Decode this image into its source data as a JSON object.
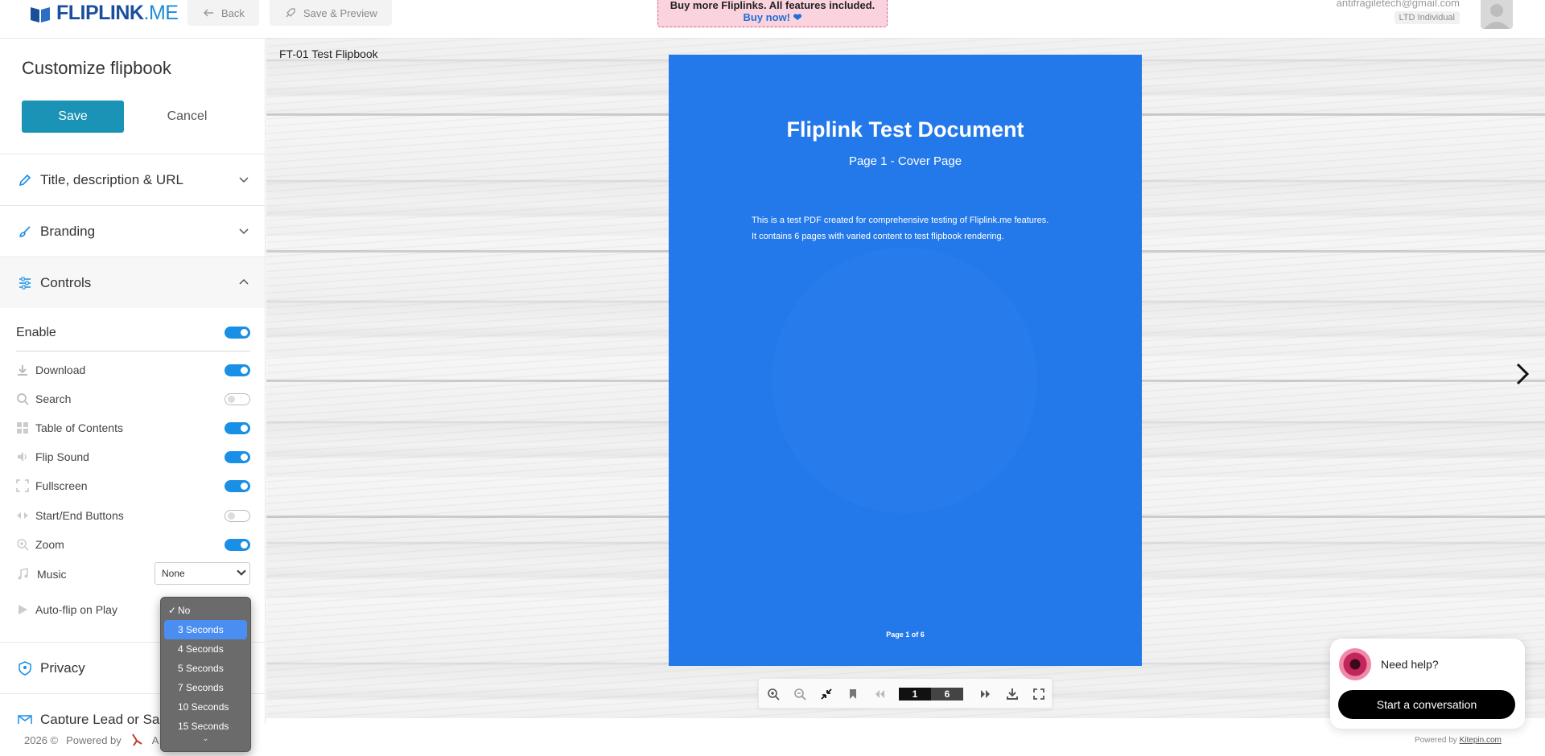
{
  "topbar": {
    "logo_main": "FLIPLINK",
    "logo_suffix": ".ME",
    "back_label": "Back",
    "save_preview_label": "Save & Preview",
    "promo_line1": "Buy more Fliplinks. All features included.",
    "promo_line2": "Buy now! ❤",
    "email": "antifragiletech@gmail.com",
    "plan": "LTD Individual"
  },
  "sidebar": {
    "title": "Customize flipbook",
    "save_label": "Save",
    "cancel_label": "Cancel",
    "sections": {
      "title_desc": "Title, description & URL",
      "branding": "Branding",
      "controls": "Controls",
      "privacy": "Privacy",
      "capture": "Capture Lead or Sa"
    },
    "enable_label": "Enable",
    "options": [
      {
        "label": "Download",
        "on": true
      },
      {
        "label": "Search",
        "on": false
      },
      {
        "label": "Table of Contents",
        "on": true
      },
      {
        "label": "Flip Sound",
        "on": true
      },
      {
        "label": "Fullscreen",
        "on": true
      },
      {
        "label": "Start/End Buttons",
        "on": false
      },
      {
        "label": "Zoom",
        "on": true
      }
    ],
    "music_label": "Music",
    "music_value": "None",
    "autoflip_label": "Auto-flip on Play",
    "autoflip_options": [
      "No",
      "3 Seconds",
      "4 Seconds",
      "5 Seconds",
      "7 Seconds",
      "10 Seconds",
      "15 Seconds"
    ],
    "autoflip_checked": "No",
    "autoflip_highlighted": "3 Seconds"
  },
  "footer": {
    "year": "2026 ©",
    "powered": "Powered by",
    "brand": "A"
  },
  "viewer": {
    "book_title": "FT-01 Test Flipbook",
    "doc_title": "Fliplink Test Document",
    "doc_subtitle": "Page 1 - Cover Page",
    "doc_body_line1": "This is a test PDF created for comprehensive testing of Fliplink.me features.",
    "doc_body_line2": "It contains 6 pages with varied content to test flipbook rendering.",
    "doc_footer": "Page 1 of 6",
    "current_page": "1",
    "total_pages": "6"
  },
  "help": {
    "text": "Need help?",
    "button": "Start a conversation",
    "powered": "Powered by",
    "powered_link": "Kitepin.com"
  },
  "colors": {
    "accent": "#1a93b6",
    "toggle_on": "#1a8fe6",
    "page_blue": "#2479ea",
    "promo_bg": "#fbd3de"
  }
}
